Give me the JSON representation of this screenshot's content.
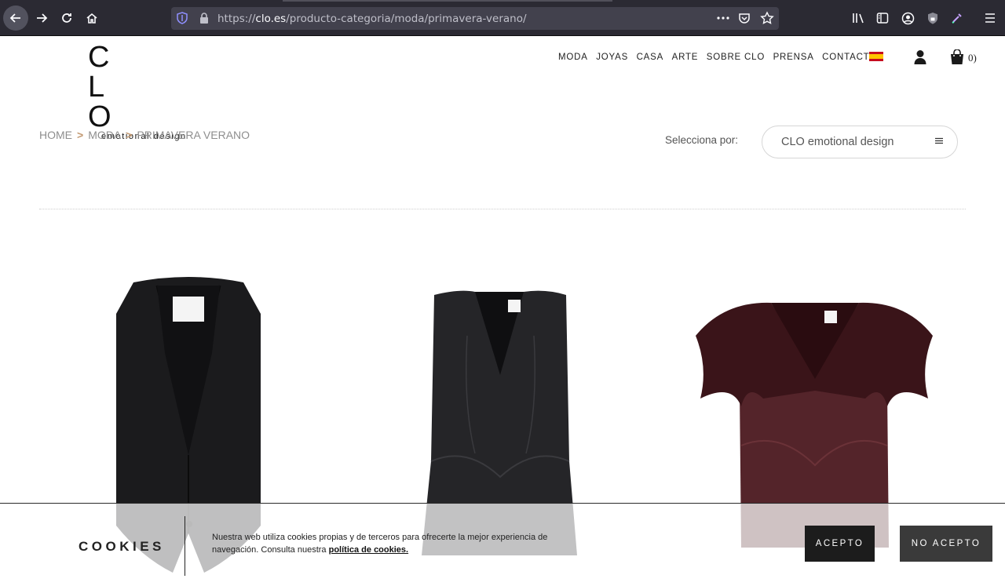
{
  "browser": {
    "url_prefix": "https://",
    "url_domain": "clo.es",
    "url_path": "/producto-categoria/moda/primavera-verano/",
    "icons": [
      "back-icon",
      "forward-icon",
      "reload-icon",
      "home-icon",
      "shield-icon",
      "lock-icon",
      "more-icon",
      "pocket-icon",
      "bookmark-star-icon",
      "library-icon",
      "sidebar-icon",
      "account-icon",
      "extension-shield-icon",
      "eyedropper-icon",
      "menu-icon"
    ]
  },
  "header": {
    "logo_mark": "C L O",
    "logo_sub": "emotional design",
    "nav": [
      "MODA",
      "JOYAS",
      "CASA",
      "ARTE",
      "SOBRE CLO",
      "PRENSA",
      "CONTACTO"
    ],
    "cart_count": "0"
  },
  "breadcrumb": {
    "items": [
      "HOME",
      "MODA",
      "PRIMAVERA VERANO"
    ],
    "separator": ">"
  },
  "sort": {
    "label": "Selecciona por:",
    "value": "CLO emotional design"
  },
  "products": [
    {
      "name": "black-vest",
      "color": "#1a1a1c"
    },
    {
      "name": "black-leather-top",
      "color": "#222226"
    },
    {
      "name": "burgundy-ruffle-top",
      "color": "#4a1c22"
    }
  ],
  "cookies": {
    "title": "COOKIES",
    "text": "Nuestra web utiliza cookies propias y de terceros para ofrecerte la mejor experiencia de navegación. Consulta nuestra",
    "link": "política de cookies.",
    "accept": "ACEPTO",
    "reject": "NO ACEPTO"
  },
  "colors": {
    "accent": "#c39a73",
    "chrome_bg": "#2b2a33",
    "urlbar_bg": "#42414d"
  }
}
